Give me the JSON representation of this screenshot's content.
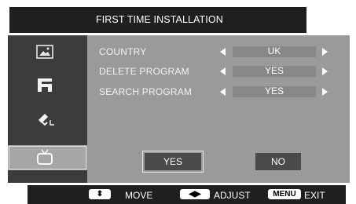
{
  "title": "FIRST TIME INSTALLATION",
  "sidebar": {
    "items": [
      {
        "icon": "picture-icon"
      },
      {
        "icon": "sound-icon"
      },
      {
        "icon": "satellite-icon"
      },
      {
        "icon": "tv-icon",
        "selected": true
      }
    ]
  },
  "settings": [
    {
      "label": "COUNTRY",
      "value": "UK"
    },
    {
      "label": "DELETE PROGRAM",
      "value": "YES"
    },
    {
      "label": "SEARCH PROGRAM",
      "value": "YES"
    }
  ],
  "buttons": {
    "yes": "YES",
    "no": "NO"
  },
  "footer": {
    "move_key": "⬍",
    "move": "MOVE",
    "adjust_key": "◀▶",
    "adjust": "ADJUST",
    "exit_key": "MENU",
    "exit": "EXIT"
  }
}
